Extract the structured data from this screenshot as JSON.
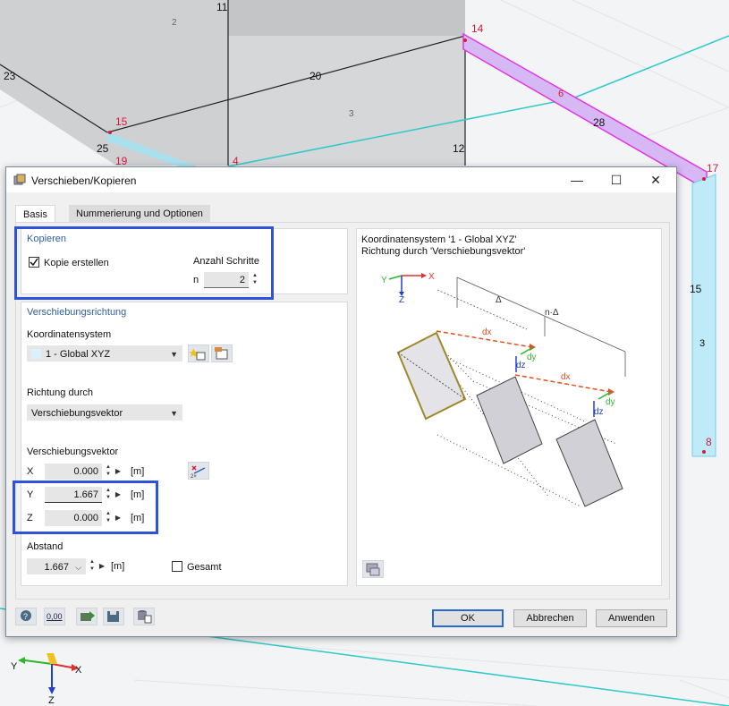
{
  "model": {
    "labels": [
      "11",
      "23",
      "20",
      "3",
      "12",
      "25",
      "15",
      "19",
      "4",
      "14",
      "6",
      "28",
      "17",
      "15",
      "3",
      "8",
      "2"
    ],
    "axes": {
      "x": "X",
      "y": "Y",
      "z": "Z"
    }
  },
  "dialog": {
    "title": "Verschieben/Kopieren",
    "controls": {
      "minimize": "—",
      "maximize": "☐",
      "close": "✕"
    },
    "tabs": [
      {
        "label": "Basis"
      },
      {
        "label": "Nummerierung und Optionen"
      }
    ],
    "kopieren": {
      "title": "Kopieren",
      "checkbox_label": "Kopie erstellen",
      "checked": true,
      "steps_label": "Anzahl Schritte",
      "n_label": "n",
      "n_value": "2"
    },
    "verschiebung": {
      "title": "Verschiebungsrichtung",
      "coord_label": "Koordinatensystem",
      "coord_value": "1 - Global XYZ",
      "richtung_label": "Richtung durch",
      "richtung_value": "Verschiebungsvektor",
      "vektor_label": "Verschiebungsvektor",
      "x_label": "X",
      "x_value": "0.000",
      "y_label": "Y",
      "y_value": "1.667",
      "z_label": "Z",
      "z_value": "0.000",
      "unit": "[m]",
      "abstand_label": "Abstand",
      "abstand_value": "1.667",
      "gesamt_label": "Gesamt"
    },
    "preview": {
      "line1": "Koordinatensystem '1 - Global XYZ'",
      "line2": "Richtung durch 'Verschiebungsvektor'",
      "delta": "Δ",
      "ndelta": "n·Δ",
      "dx": "dx",
      "dy": "dy",
      "dz": "dz",
      "axis_y": "Y",
      "axis_x": "X",
      "axis_z": "Z"
    },
    "buttons": {
      "ok": "OK",
      "cancel": "Abbrechen",
      "apply": "Anwenden"
    },
    "units_icon_text": "0,00"
  }
}
